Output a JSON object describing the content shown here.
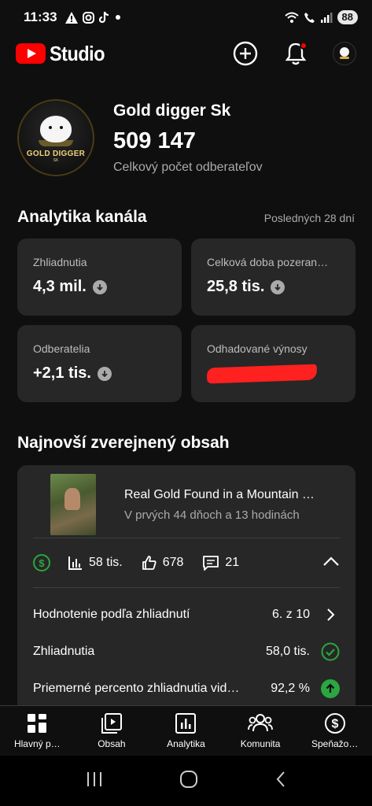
{
  "status_bar": {
    "time": "11:33",
    "battery": "88"
  },
  "app": {
    "name": "Studio"
  },
  "channel": {
    "avatar_text": "GOLD DIGGER",
    "avatar_subtext": "SK",
    "name": "Gold digger Sk",
    "subscribers": "509 147",
    "subscribers_label": "Celkový počet odberateľov"
  },
  "analytics": {
    "title": "Analytika kanála",
    "period": "Posledných 28 dní",
    "cards": [
      {
        "label": "Zhliadnutia",
        "value": "4,3 mil."
      },
      {
        "label": "Celková doba pozeran…",
        "value": "25,8 tis."
      },
      {
        "label": "Odberatelia",
        "value": "+2,1 tis."
      },
      {
        "label": "Odhadované výnosy",
        "value": ""
      }
    ]
  },
  "latest": {
    "title": "Najnovší zverejnený obsah",
    "video_title": "Real Gold Found in a Mountain …",
    "video_subtitle": "V prvých 44 dňoch a 13 hodinách",
    "views": "58 tis.",
    "likes": "678",
    "comments": "21",
    "metrics": [
      {
        "label": "Hodnotenie podľa zhliadnutí",
        "value": "6. z 10"
      },
      {
        "label": "Zhliadnutia",
        "value": "58,0 tis."
      },
      {
        "label": "Priemerné percento zhliadnutia vid…",
        "value": "92,2 %"
      }
    ]
  },
  "nav": {
    "items": [
      {
        "label": "Hlavný p…",
        "icon": "dashboard-icon"
      },
      {
        "label": "Obsah",
        "icon": "content-icon"
      },
      {
        "label": "Analytika",
        "icon": "analytics-icon"
      },
      {
        "label": "Komunita",
        "icon": "community-icon"
      },
      {
        "label": "Speňažo…",
        "icon": "earn-icon"
      }
    ]
  },
  "colors": {
    "accent_red": "#ff0000",
    "success_green": "#2ba640",
    "card_bg": "#272727",
    "page_bg": "#0f0f0f"
  }
}
